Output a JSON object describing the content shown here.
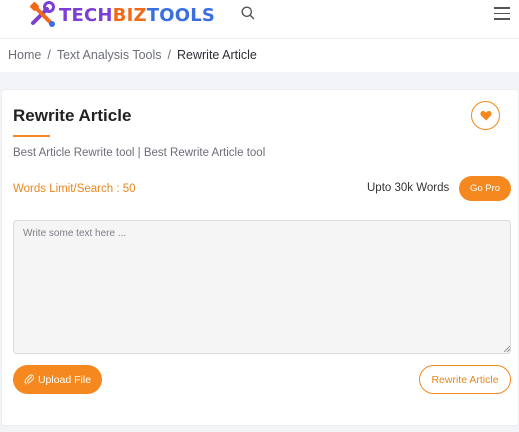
{
  "header": {
    "logo": {
      "part1": "TECH",
      "part2": "BIZ",
      "part3": "TOOLS"
    },
    "icons": {
      "search": "search-icon",
      "menu": "hamburger-menu-icon"
    }
  },
  "breadcrumb": {
    "items": [
      "Home",
      "Text Analysis Tools"
    ],
    "separator": "/",
    "current": "Rewrite Article"
  },
  "tool": {
    "title": "Rewrite Article",
    "subtitle": "Best Article Rewrite tool | Best Rewrite Article tool",
    "words_limit": "Words Limit/Search : 50",
    "upto_text": "Upto 30k Words",
    "go_pro_label": "Go Pro",
    "textarea_placeholder": "Write some text here ...",
    "textarea_value": "",
    "upload_label": "Upload File",
    "rewrite_label": "Rewrite Article"
  },
  "colors": {
    "accent": "#f5891f",
    "accent_text": "#e8871e",
    "logo_tech": "#7c3fd6",
    "logo_biz": "#f06a1a",
    "logo_tools": "#3b6fe0",
    "page_bg": "#f3f4f8"
  }
}
